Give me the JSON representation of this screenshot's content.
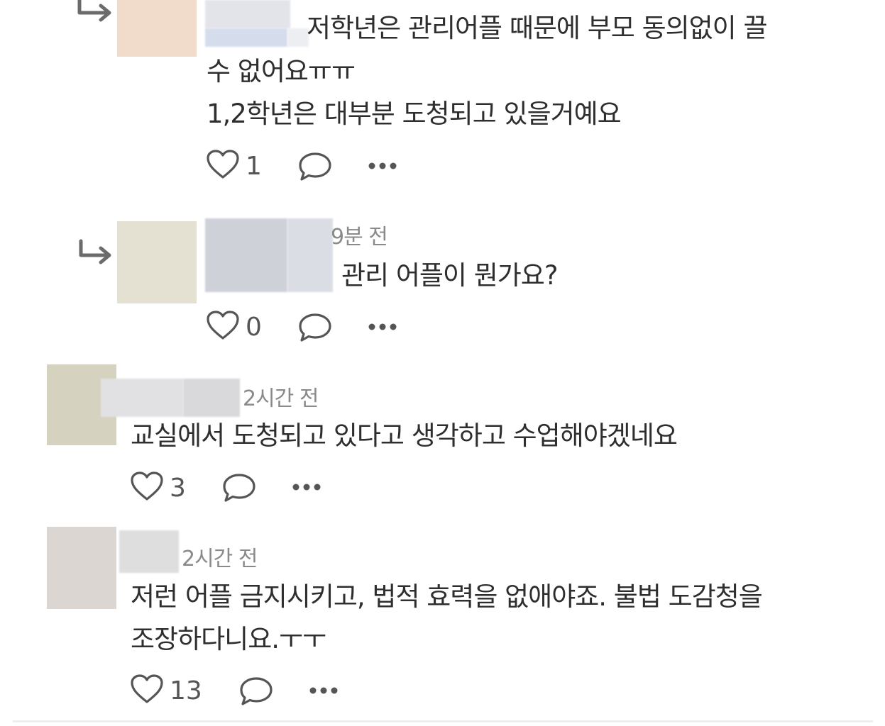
{
  "comments": [
    {
      "username": "",
      "time": "",
      "lines": [
        "저학년은 관리어플 때문에 부모 동의없이 끌",
        "수 없어요ㅠㅠ",
        "1,2학년은 대부분 도청되고 있을거예요"
      ],
      "likes": "1"
    },
    {
      "username": "",
      "time": "9분 전",
      "lines": [
        "관리 어플이 뭔가요?"
      ],
      "likes": "0"
    },
    {
      "username": "",
      "time": "2시간 전",
      "lines": [
        "교실에서 도청되고 있다고 생각하고 수업해야겠네요"
      ],
      "likes": "3"
    },
    {
      "username": "",
      "time": "2시간 전",
      "lines": [
        "저런 어플 금지시키고, 법적 효력을 없애야죠. 불법 도감청을",
        "조장하다니요.ㅜㅜ"
      ],
      "likes": "13"
    }
  ],
  "icons": {
    "reply": "reply-arrow-icon",
    "like": "heart-icon",
    "comment": "speech-bubble-icon",
    "more": "more-dots-icon"
  },
  "colors": {
    "text": "#2e2e2e",
    "meta": "#8a8a8a",
    "icon": "#555555"
  }
}
